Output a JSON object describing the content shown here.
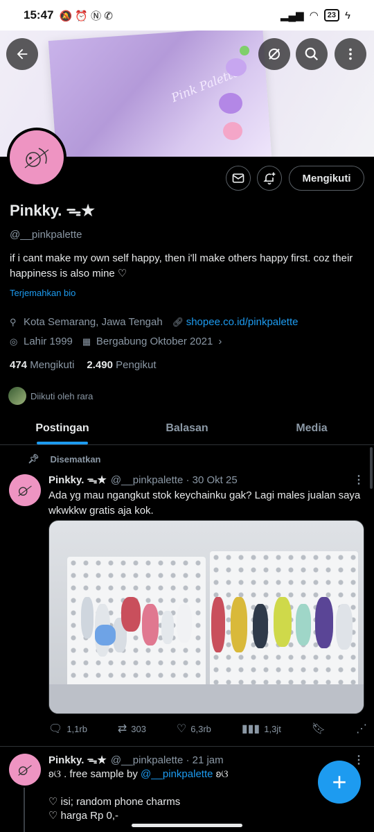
{
  "statusbar": {
    "time": "15:47",
    "left_icons": "🔕 ⏰ Ⓝ ✆",
    "battery": "23"
  },
  "banner": {
    "card_text": "Pink Palette"
  },
  "header_buttons": {
    "back": "back-arrow-icon",
    "hide": "hide-icon",
    "search": "search-icon",
    "more": "more-vertical-icon"
  },
  "profile": {
    "name": "Pinkky. ᯓ★",
    "handle": "@__pinkpalette",
    "bio": "if i cant make my own self happy, then i'll make others happy first. coz their happiness is also mine ♡",
    "translate": "Terjemahkan bio",
    "location": "Kota Semarang, Jawa Tengah",
    "website": "shopee.co.id/pinkpalette",
    "birth": "Lahir 1999",
    "joined": "Bergabung Oktober 2021",
    "following_count": "474",
    "following_label": "Mengikuti",
    "followers_count": "2.490",
    "followers_label": "Pengikut",
    "followed_by": "Diikuti oleh rara",
    "follow_button": "Mengikuti"
  },
  "tabs": [
    {
      "label": "Postingan",
      "active": true
    },
    {
      "label": "Balasan",
      "active": false
    },
    {
      "label": "Media",
      "active": false
    }
  ],
  "pinned_label": "Disematkan",
  "posts": [
    {
      "name": "Pinkky. ᯓ★",
      "meta": "@__pinkpalette · 30 Okt 25",
      "text": "Ada yg mau ngangkut stok keychainku gak? Lagi males jualan saya wkwkkw gratis aja kok.",
      "replies": "1,1rb",
      "reposts": "303",
      "likes": "6,3rb",
      "views": "1,3jt"
    },
    {
      "name": "Pinkky. ᯓ★",
      "meta": "@__pinkpalette · 21 jam",
      "line1_prefix": "ʚଓ . free sample by ",
      "line1_mention": "@__pinkpalette",
      "line1_suffix": " ʚଓ",
      "line2": "♡ isi; random phone charms",
      "line3": "♡ harga Rp 0,-"
    }
  ],
  "colors": {
    "accent": "#1d9bf0",
    "avatar_bg": "#ee94c2",
    "background": "#000000",
    "muted": "#8b98a5"
  }
}
